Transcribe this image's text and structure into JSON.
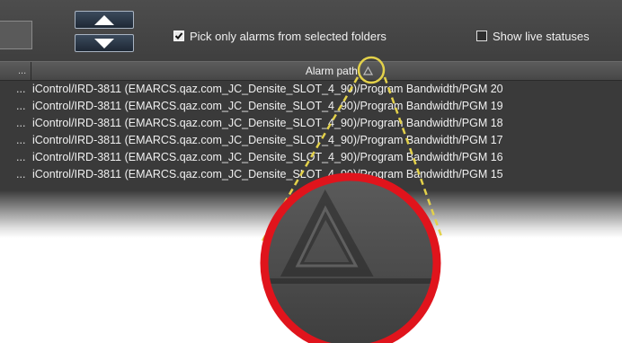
{
  "toolbar": {
    "pick_only_label": "Pick only alarms from selected folders",
    "pick_only_checked": true,
    "live_status_label": "Show live statuses",
    "live_status_checked": false
  },
  "table": {
    "first_col_header": "...",
    "path_header": "Alarm path",
    "sort_direction": "ascending",
    "rows": [
      {
        "index": "...",
        "path": "iControl/IRD-3811 (EMARCS.qaz.com_JC_Densite_SLOT_4_90)/Program Bandwidth/PGM 20"
      },
      {
        "index": "...",
        "path": "iControl/IRD-3811 (EMARCS.qaz.com_JC_Densite_SLOT_4_90)/Program Bandwidth/PGM 19"
      },
      {
        "index": "...",
        "path": "iControl/IRD-3811 (EMARCS.qaz.com_JC_Densite_SLOT_4_90)/Program Bandwidth/PGM 18"
      },
      {
        "index": "...",
        "path": "iControl/IRD-3811 (EMARCS.qaz.com_JC_Densite_SLOT_4_90)/Program Bandwidth/PGM 17"
      },
      {
        "index": "...",
        "path": "iControl/IRD-3811 (EMARCS.qaz.com_JC_Densite_SLOT_4_90)/Program Bandwidth/PGM 16"
      },
      {
        "index": "...",
        "path": "iControl/IRD-3811 (EMARCS.qaz.com_JC_Densite_SLOT_4_90)/Program Bandwidth/PGM 15"
      }
    ]
  },
  "callout": {
    "ring_color": "#e3d14a",
    "circle_border_color": "#e0141c",
    "icon": "sort-ascending-triangle-icon"
  }
}
